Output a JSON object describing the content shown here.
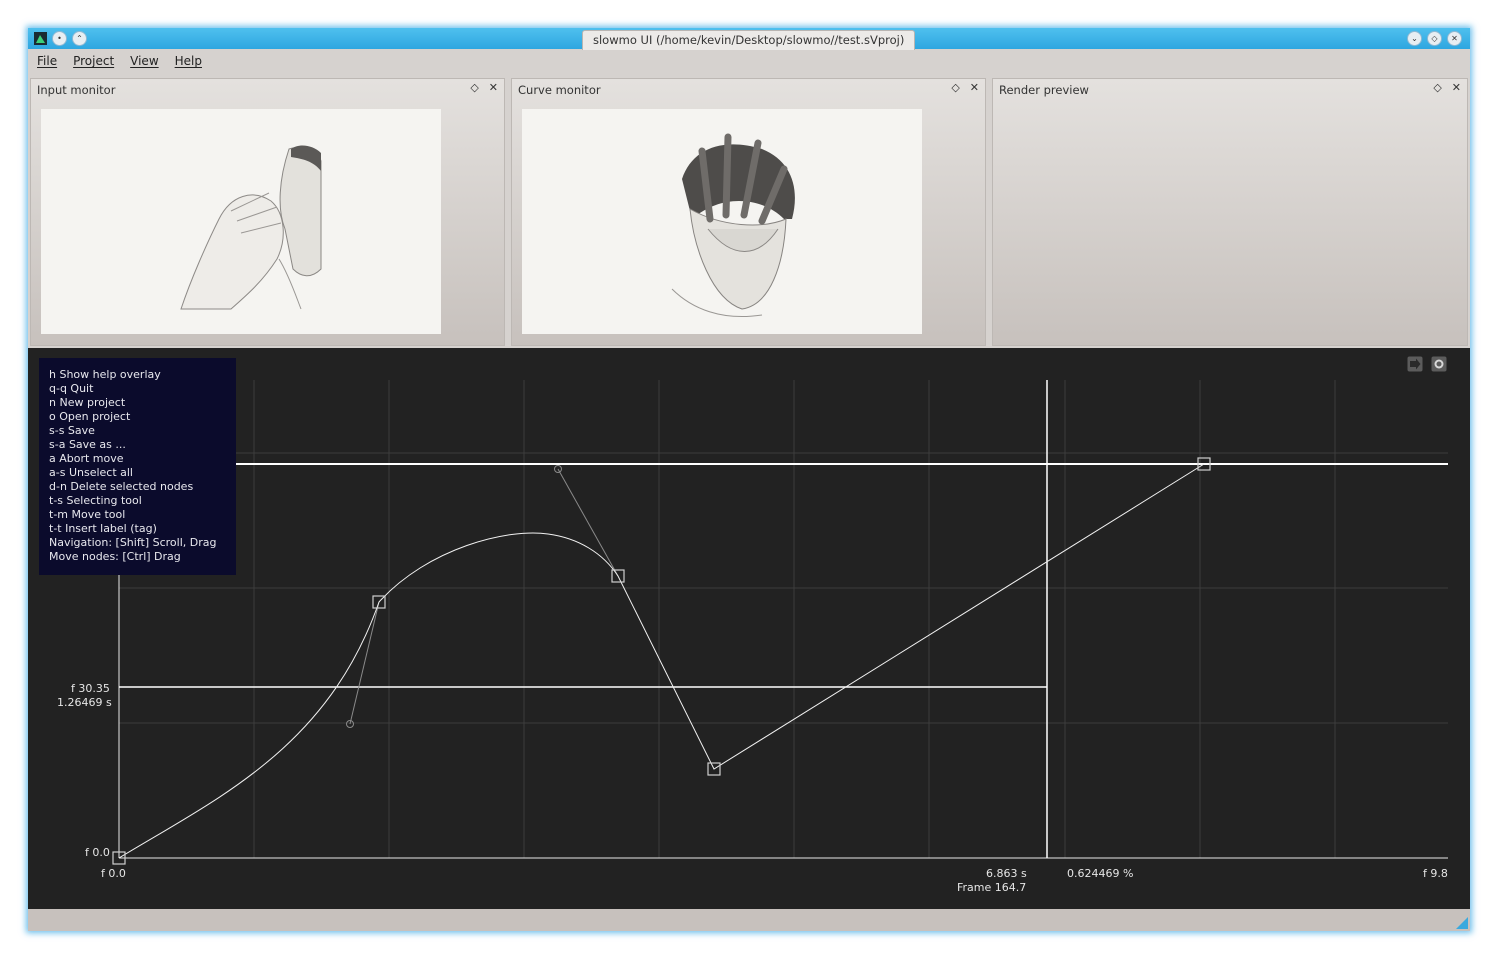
{
  "window": {
    "title": "slowmo UI (/home/kevin/Desktop/slowmo//test.sVproj)",
    "accent_color": "#2ea6e0"
  },
  "menu": [
    "File",
    "Project",
    "View",
    "Help"
  ],
  "docks": {
    "input": {
      "title": "Input monitor"
    },
    "curve": {
      "title": "Curve monitor"
    },
    "render": {
      "title": "Render preview"
    }
  },
  "help_overlay": {
    "lines": [
      "h Show help overlay",
      "q-q Quit",
      "n New project",
      "o Open project",
      "s-s Save",
      "s-a Save as ...",
      "a Abort move",
      "a-s Unselect all",
      "d-n Delete selected nodes",
      "t-s Selecting tool",
      "t-m Move tool",
      "t-t Insert label (tag)",
      "Navigation: [Shift] Scroll, Drag",
      "Move nodes: [Ctrl]  Drag"
    ]
  },
  "canvas": {
    "y_label_cursor_frame": "f 30.35",
    "y_label_cursor_time": "1.26469 s",
    "y_origin": "f 0.0",
    "x_origin": "f 0.0",
    "x_cursor_time": "6.863 s",
    "x_cursor_frame": "Frame 164.7",
    "cursor_percent": "0.624469 %",
    "x_end": "f 9.8",
    "icons": [
      "render-arrow-icon",
      "record-circle-icon"
    ]
  }
}
